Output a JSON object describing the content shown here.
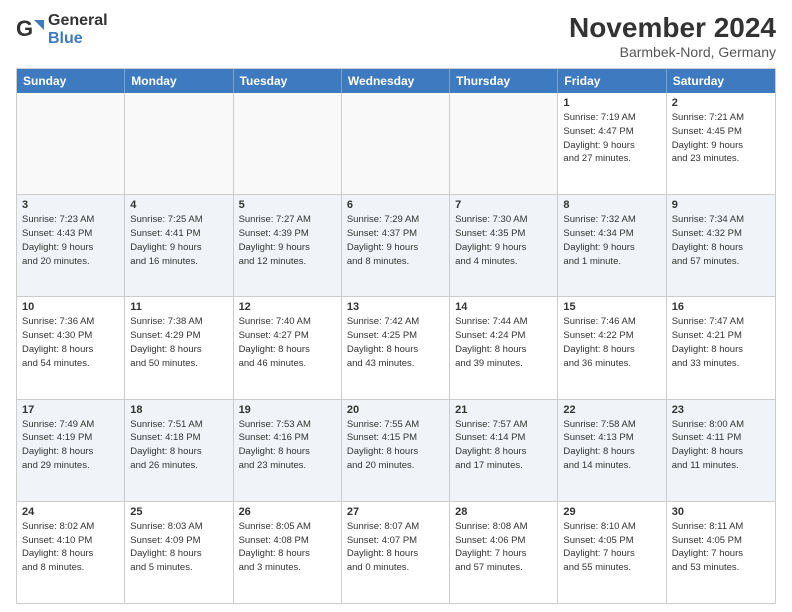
{
  "logo": {
    "general": "General",
    "blue": "Blue"
  },
  "title": "November 2024",
  "location": "Barmbek-Nord, Germany",
  "header_days": [
    "Sunday",
    "Monday",
    "Tuesday",
    "Wednesday",
    "Thursday",
    "Friday",
    "Saturday"
  ],
  "weeks": [
    {
      "alt": false,
      "cells": [
        {
          "day": "",
          "info": ""
        },
        {
          "day": "",
          "info": ""
        },
        {
          "day": "",
          "info": ""
        },
        {
          "day": "",
          "info": ""
        },
        {
          "day": "",
          "info": ""
        },
        {
          "day": "1",
          "info": "Sunrise: 7:19 AM\nSunset: 4:47 PM\nDaylight: 9 hours\nand 27 minutes."
        },
        {
          "day": "2",
          "info": "Sunrise: 7:21 AM\nSunset: 4:45 PM\nDaylight: 9 hours\nand 23 minutes."
        }
      ]
    },
    {
      "alt": true,
      "cells": [
        {
          "day": "3",
          "info": "Sunrise: 7:23 AM\nSunset: 4:43 PM\nDaylight: 9 hours\nand 20 minutes."
        },
        {
          "day": "4",
          "info": "Sunrise: 7:25 AM\nSunset: 4:41 PM\nDaylight: 9 hours\nand 16 minutes."
        },
        {
          "day": "5",
          "info": "Sunrise: 7:27 AM\nSunset: 4:39 PM\nDaylight: 9 hours\nand 12 minutes."
        },
        {
          "day": "6",
          "info": "Sunrise: 7:29 AM\nSunset: 4:37 PM\nDaylight: 9 hours\nand 8 minutes."
        },
        {
          "day": "7",
          "info": "Sunrise: 7:30 AM\nSunset: 4:35 PM\nDaylight: 9 hours\nand 4 minutes."
        },
        {
          "day": "8",
          "info": "Sunrise: 7:32 AM\nSunset: 4:34 PM\nDaylight: 9 hours\nand 1 minute."
        },
        {
          "day": "9",
          "info": "Sunrise: 7:34 AM\nSunset: 4:32 PM\nDaylight: 8 hours\nand 57 minutes."
        }
      ]
    },
    {
      "alt": false,
      "cells": [
        {
          "day": "10",
          "info": "Sunrise: 7:36 AM\nSunset: 4:30 PM\nDaylight: 8 hours\nand 54 minutes."
        },
        {
          "day": "11",
          "info": "Sunrise: 7:38 AM\nSunset: 4:29 PM\nDaylight: 8 hours\nand 50 minutes."
        },
        {
          "day": "12",
          "info": "Sunrise: 7:40 AM\nSunset: 4:27 PM\nDaylight: 8 hours\nand 46 minutes."
        },
        {
          "day": "13",
          "info": "Sunrise: 7:42 AM\nSunset: 4:25 PM\nDaylight: 8 hours\nand 43 minutes."
        },
        {
          "day": "14",
          "info": "Sunrise: 7:44 AM\nSunset: 4:24 PM\nDaylight: 8 hours\nand 39 minutes."
        },
        {
          "day": "15",
          "info": "Sunrise: 7:46 AM\nSunset: 4:22 PM\nDaylight: 8 hours\nand 36 minutes."
        },
        {
          "day": "16",
          "info": "Sunrise: 7:47 AM\nSunset: 4:21 PM\nDaylight: 8 hours\nand 33 minutes."
        }
      ]
    },
    {
      "alt": true,
      "cells": [
        {
          "day": "17",
          "info": "Sunrise: 7:49 AM\nSunset: 4:19 PM\nDaylight: 8 hours\nand 29 minutes."
        },
        {
          "day": "18",
          "info": "Sunrise: 7:51 AM\nSunset: 4:18 PM\nDaylight: 8 hours\nand 26 minutes."
        },
        {
          "day": "19",
          "info": "Sunrise: 7:53 AM\nSunset: 4:16 PM\nDaylight: 8 hours\nand 23 minutes."
        },
        {
          "day": "20",
          "info": "Sunrise: 7:55 AM\nSunset: 4:15 PM\nDaylight: 8 hours\nand 20 minutes."
        },
        {
          "day": "21",
          "info": "Sunrise: 7:57 AM\nSunset: 4:14 PM\nDaylight: 8 hours\nand 17 minutes."
        },
        {
          "day": "22",
          "info": "Sunrise: 7:58 AM\nSunset: 4:13 PM\nDaylight: 8 hours\nand 14 minutes."
        },
        {
          "day": "23",
          "info": "Sunrise: 8:00 AM\nSunset: 4:11 PM\nDaylight: 8 hours\nand 11 minutes."
        }
      ]
    },
    {
      "alt": false,
      "cells": [
        {
          "day": "24",
          "info": "Sunrise: 8:02 AM\nSunset: 4:10 PM\nDaylight: 8 hours\nand 8 minutes."
        },
        {
          "day": "25",
          "info": "Sunrise: 8:03 AM\nSunset: 4:09 PM\nDaylight: 8 hours\nand 5 minutes."
        },
        {
          "day": "26",
          "info": "Sunrise: 8:05 AM\nSunset: 4:08 PM\nDaylight: 8 hours\nand 3 minutes."
        },
        {
          "day": "27",
          "info": "Sunrise: 8:07 AM\nSunset: 4:07 PM\nDaylight: 8 hours\nand 0 minutes."
        },
        {
          "day": "28",
          "info": "Sunrise: 8:08 AM\nSunset: 4:06 PM\nDaylight: 7 hours\nand 57 minutes."
        },
        {
          "day": "29",
          "info": "Sunrise: 8:10 AM\nSunset: 4:05 PM\nDaylight: 7 hours\nand 55 minutes."
        },
        {
          "day": "30",
          "info": "Sunrise: 8:11 AM\nSunset: 4:05 PM\nDaylight: 7 hours\nand 53 minutes."
        }
      ]
    }
  ]
}
